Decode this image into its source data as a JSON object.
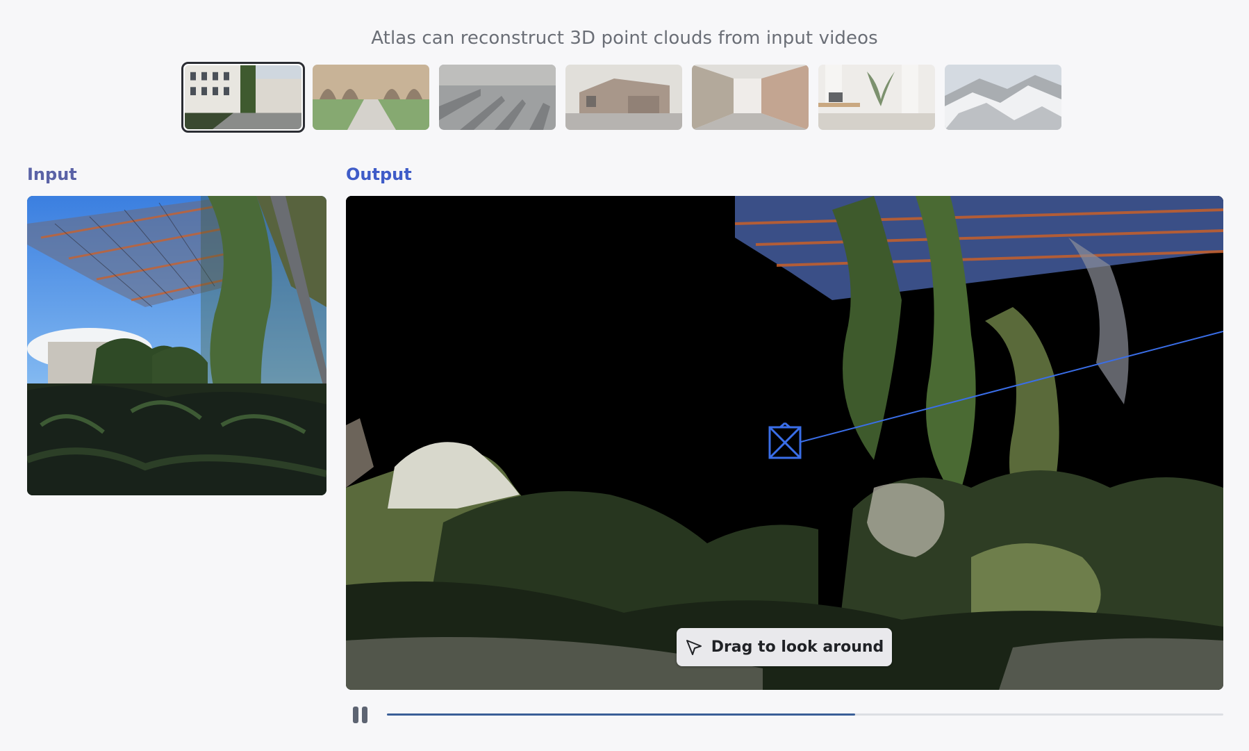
{
  "headline": "Atlas can reconstruct 3D point clouds from input videos",
  "thumbnails": [
    {
      "scene": "building-courtyard",
      "selected": true
    },
    {
      "scene": "arched-courtyard",
      "selected": false
    },
    {
      "scene": "warehouse-shelves",
      "selected": false
    },
    {
      "scene": "house-garage",
      "selected": false
    },
    {
      "scene": "brick-alley",
      "selected": false
    },
    {
      "scene": "office-interior",
      "selected": false
    },
    {
      "scene": "snowy-mountain",
      "selected": false
    }
  ],
  "input_label": "Input",
  "output_label": "Output",
  "drag_hint": {
    "label": "Drag to look around",
    "icon": "cursor-arrow-icon"
  },
  "playback": {
    "state": "playing",
    "control_icon": "pause-icon",
    "progress": 0.56
  },
  "colors": {
    "output_label": "#3f5cc8",
    "input_label": "#5a62a6",
    "camera_frustum": "#3a6ee8",
    "progress_fill": "#3a5f98"
  }
}
